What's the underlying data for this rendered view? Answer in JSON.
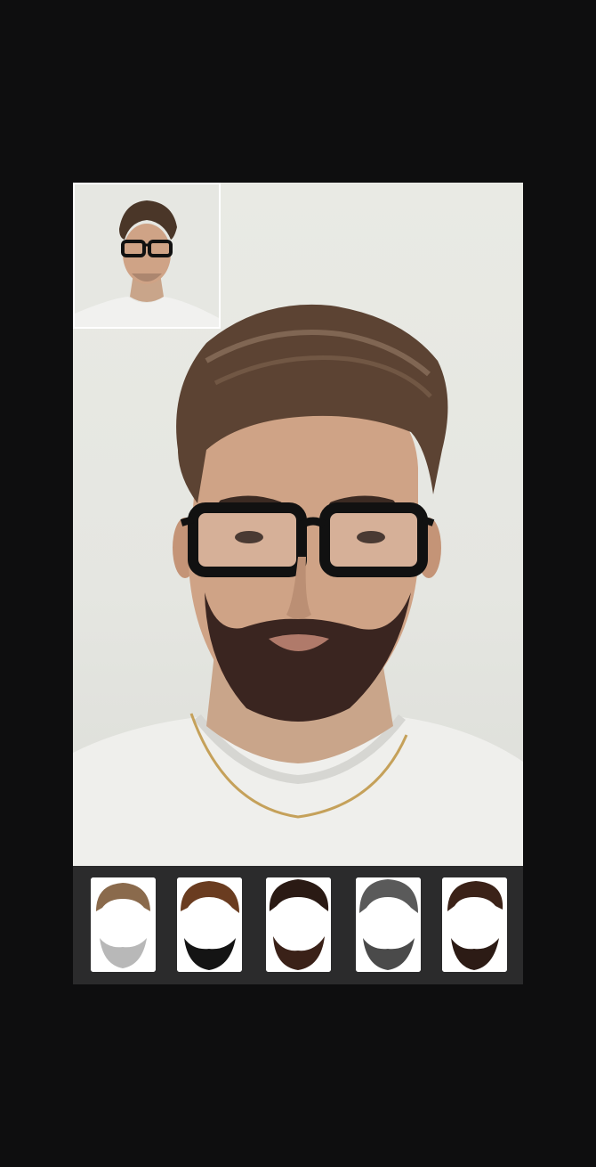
{
  "app": {
    "screen": "hairstyle-beard-editor",
    "accent": "#ffffff",
    "background": "#0e0e0f"
  },
  "preview": {
    "icon": "edited-face-photo"
  },
  "original_thumbnail": {
    "icon": "original-face-photo",
    "border_color": "#ffffff"
  },
  "style_tray": {
    "background": "#2b2b2c",
    "items": [
      {
        "id": "style-1",
        "icon": "light-brown-hair-light-beard-icon",
        "hair": "#8a6a4c",
        "beard": "#9a9a9a"
      },
      {
        "id": "style-2",
        "icon": "brown-hair-black-beard-icon",
        "hair": "#6a3c20",
        "beard": "#141414"
      },
      {
        "id": "style-3",
        "icon": "dark-hair-dark-brown-beard-icon",
        "hair": "#2a1a14",
        "beard": "#3a2118"
      },
      {
        "id": "style-4",
        "icon": "gray-hair-gray-beard-icon",
        "hair": "#5a5a5a",
        "beard": "#4a4a4a"
      },
      {
        "id": "style-5",
        "icon": "dark-brown-hair-beard-icon",
        "hair": "#3b2218",
        "beard": "#2c1b15"
      }
    ]
  }
}
